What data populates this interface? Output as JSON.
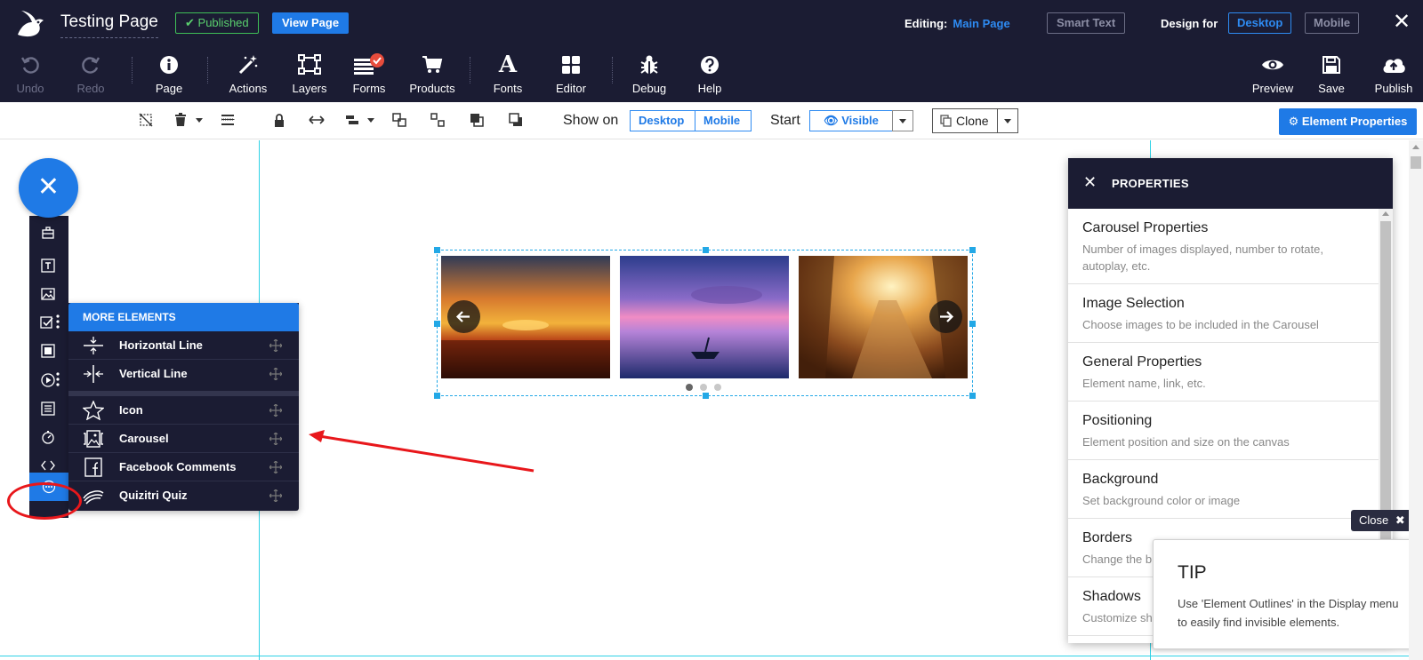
{
  "header": {
    "page_title": "Testing Page",
    "published_label": "Published",
    "view_page_label": "View Page",
    "editing_label": "Editing:",
    "editing_value": "Main Page",
    "smart_text_label": "Smart Text",
    "design_for_label": "Design for",
    "desktop_label": "Desktop",
    "mobile_label": "Mobile",
    "close_symbol": "✕"
  },
  "toolbar": {
    "items": [
      {
        "label": "Undo",
        "icon": "undo-icon",
        "enabled": false
      },
      {
        "label": "Redo",
        "icon": "redo-icon",
        "enabled": false
      },
      {
        "label": "Page",
        "icon": "info-icon",
        "enabled": true
      },
      {
        "label": "Actions",
        "icon": "magic-wand-icon",
        "enabled": true
      },
      {
        "label": "Layers",
        "icon": "layers-icon",
        "enabled": true
      },
      {
        "label": "Forms",
        "icon": "forms-icon",
        "enabled": true
      },
      {
        "label": "Products",
        "icon": "cart-icon",
        "enabled": true
      },
      {
        "label": "Fonts",
        "icon": "font-icon",
        "enabled": true
      },
      {
        "label": "Editor",
        "icon": "grid-icon",
        "enabled": true
      },
      {
        "label": "Debug",
        "icon": "bug-icon",
        "enabled": true
      },
      {
        "label": "Help",
        "icon": "help-icon",
        "enabled": true
      }
    ],
    "right_items": [
      {
        "label": "Preview",
        "icon": "eye-icon"
      },
      {
        "label": "Save",
        "icon": "save-icon"
      },
      {
        "label": "Publish",
        "icon": "cloud-upload-icon"
      }
    ]
  },
  "element_toolbar": {
    "show_on_label": "Show on",
    "show_desktop": "Desktop",
    "show_mobile": "Mobile",
    "start_label": "Start",
    "visible_label": "Visible",
    "clone_label": "Clone",
    "element_properties_label": "Element Properties"
  },
  "more_elements": {
    "title": "MORE ELEMENTS",
    "items": [
      {
        "label": "Horizontal Line",
        "icon": "horizontal-line-icon"
      },
      {
        "label": "Vertical Line",
        "icon": "vertical-line-icon"
      },
      {
        "label": "Icon",
        "icon": "star-icon"
      },
      {
        "label": "Carousel",
        "icon": "carousel-icon"
      },
      {
        "label": "Facebook Comments",
        "icon": "facebook-icon"
      },
      {
        "label": "Quizitri Quiz",
        "icon": "quiz-icon"
      }
    ]
  },
  "properties_panel": {
    "title": "PROPERTIES",
    "close_symbol": "✕",
    "items": [
      {
        "title": "Carousel Properties",
        "desc": "Number of images displayed, number to rotate, autoplay, etc."
      },
      {
        "title": "Image Selection",
        "desc": "Choose images to be included in the Carousel"
      },
      {
        "title": "General Properties",
        "desc": "Element name, link, etc."
      },
      {
        "title": "Positioning",
        "desc": "Element position and size on the canvas"
      },
      {
        "title": "Background",
        "desc": "Set background color or image"
      },
      {
        "title": "Borders",
        "desc": "Change the b"
      },
      {
        "title": "Shadows",
        "desc": "Customize sh"
      }
    ]
  },
  "tip": {
    "close_label": "Close",
    "close_symbol": "✖",
    "title": "TIP",
    "text": "Use 'Element Outlines' in the Display menu to easily find invisible elements."
  },
  "carousel": {
    "dots": 3,
    "active_dot": 0
  },
  "colors": {
    "dark_bg": "#1b1c33",
    "accent": "#1f7ae6",
    "published_green": "#3fbf57",
    "guide_cyan": "#2fd2e6",
    "annotation_red": "#e8171b"
  }
}
